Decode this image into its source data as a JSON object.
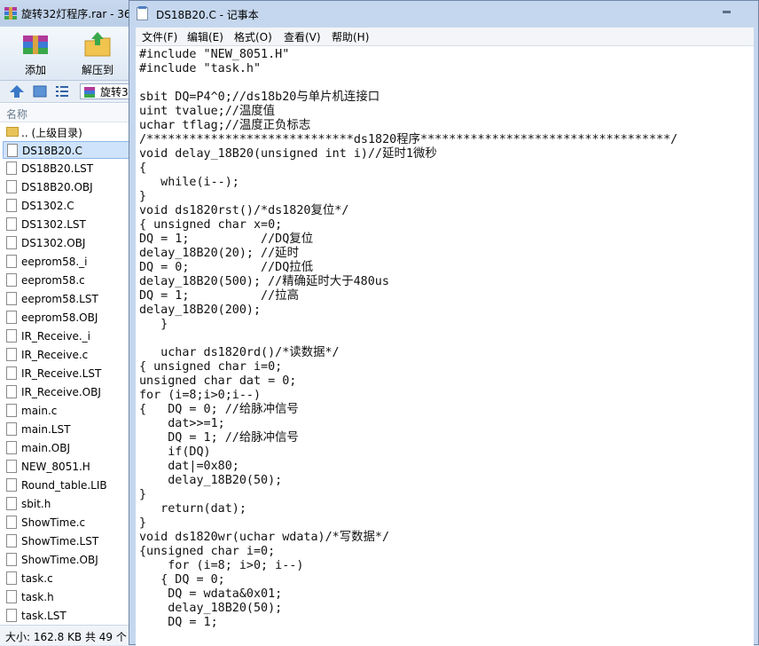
{
  "archive_window": {
    "title": "旋转32灯程序.rar - 36",
    "toolbar": {
      "add_label": "添加",
      "extract_label": "解压到"
    },
    "address": "旋转3",
    "column_name": "名称",
    "files": [
      {
        "name": ".. (上级目录)",
        "type": "folder"
      },
      {
        "name": "DS18B20.C",
        "type": "file",
        "selected": true
      },
      {
        "name": "DS18B20.LST",
        "type": "file"
      },
      {
        "name": "DS18B20.OBJ",
        "type": "file"
      },
      {
        "name": "DS1302.C",
        "type": "file"
      },
      {
        "name": "DS1302.LST",
        "type": "file"
      },
      {
        "name": "DS1302.OBJ",
        "type": "file"
      },
      {
        "name": "eeprom58._i",
        "type": "file"
      },
      {
        "name": "eeprom58.c",
        "type": "file"
      },
      {
        "name": "eeprom58.LST",
        "type": "file"
      },
      {
        "name": "eeprom58.OBJ",
        "type": "file"
      },
      {
        "name": "IR_Receive._i",
        "type": "file"
      },
      {
        "name": "IR_Receive.c",
        "type": "file"
      },
      {
        "name": "IR_Receive.LST",
        "type": "file"
      },
      {
        "name": "IR_Receive.OBJ",
        "type": "file"
      },
      {
        "name": "main.c",
        "type": "file"
      },
      {
        "name": "main.LST",
        "type": "file"
      },
      {
        "name": "main.OBJ",
        "type": "file"
      },
      {
        "name": "NEW_8051.H",
        "type": "file"
      },
      {
        "name": "Round_table.LIB",
        "type": "file"
      },
      {
        "name": "sbit.h",
        "type": "file"
      },
      {
        "name": "ShowTime.c",
        "type": "file"
      },
      {
        "name": "ShowTime.LST",
        "type": "file"
      },
      {
        "name": "ShowTime.OBJ",
        "type": "file"
      },
      {
        "name": "task.c",
        "type": "file"
      },
      {
        "name": "task.h",
        "type": "file"
      },
      {
        "name": "task.LST",
        "type": "file"
      }
    ],
    "status": "大小: 162.8 KB 共 49 个"
  },
  "notepad": {
    "title": "DS18B20.C - 记事本",
    "menu": [
      "文件(F)",
      "编辑(E)",
      "格式(O)",
      "查看(V)",
      "帮助(H)"
    ],
    "code": "#include \"NEW_8051.H\"\n#include \"task.h\"\n\nsbit DQ=P4^0;//ds18b20与单片机连接口\nuint tvalue;//温度值\nuchar tflag;//温度正负标志\n/*****************************ds1820程序***********************************/\nvoid delay_18B20(unsigned int i)//延时1微秒\n{\n   while(i--);\n}\nvoid ds1820rst()/*ds1820复位*/\n{ unsigned char x=0;\nDQ = 1;          //DQ复位\ndelay_18B20(20); //延时\nDQ = 0;          //DQ拉低\ndelay_18B20(500); //精确延时大于480us\nDQ = 1;          //拉高\ndelay_18B20(200);\n   }\n\n   uchar ds1820rd()/*读数据*/\n{ unsigned char i=0;\nunsigned char dat = 0;\nfor (i=8;i>0;i--)\n{   DQ = 0; //给脉冲信号\n    dat>>=1;\n    DQ = 1; //给脉冲信号\n    if(DQ)\n    dat|=0x80;\n    delay_18B20(50);\n}\n   return(dat);\n}\nvoid ds1820wr(uchar wdata)/*写数据*/\n{unsigned char i=0;\n    for (i=8; i>0; i--)\n   { DQ = 0;\n    DQ = wdata&0x01;\n    delay_18B20(50);\n    DQ = 1;"
  }
}
